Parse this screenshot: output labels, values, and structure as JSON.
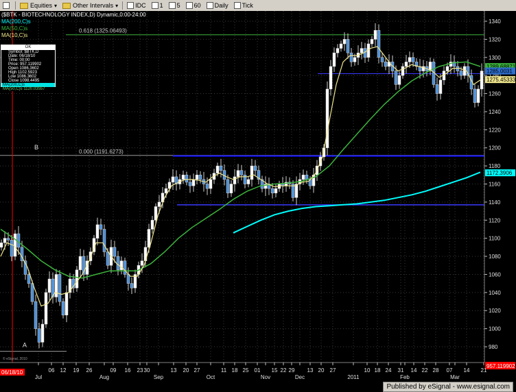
{
  "toolbar": {
    "items": [
      {
        "label": "Equities",
        "icon": "folder-icon"
      },
      {
        "label": "Other Intervals",
        "icon": "folder-icon"
      },
      {
        "label": "IDC",
        "icon": "box-icon"
      },
      {
        "label": "1",
        "icon": "box-icon"
      },
      {
        "label": "5",
        "icon": "box-icon"
      },
      {
        "label": "60",
        "icon": "box-icon"
      },
      {
        "label": "Daily",
        "icon": "box-icon"
      },
      {
        "label": "Tick",
        "icon": "box-icon"
      }
    ]
  },
  "header": {
    "title": "($BTK - BIOTECHNOLOGY INDEX,D) Dynamic,0:00-24:00",
    "legend": [
      {
        "label": "MA(200,C)s",
        "color": "#00ffff"
      },
      {
        "label": "MA(50,C)s",
        "color": "#3cb43c"
      },
      {
        "label": "MA(10,C)s",
        "color": "#f0e68c"
      }
    ]
  },
  "infobox": {
    "header": "OK",
    "rows": [
      "Symbol: $BTK,D",
      "Date: 06/18/10",
      "Time: 00:00",
      "Price: 957.119902",
      "Open 1086.3602",
      "High 1102.5923",
      "Low 1086.3602",
      "Close 1098.4495"
    ],
    "ma_rows": [
      {
        "label": "MA(200,C)s",
        "value": ""
      },
      {
        "label": "MA(50,C)s",
        "value": "1120.03557"
      }
    ]
  },
  "annotations": {
    "fib_618": "0.618 (1325.06493)",
    "fib_000": "0.000 (1191.6273)",
    "label_a": "A",
    "label_b": "B",
    "credit": "© eSignal, 2010"
  },
  "footer": {
    "published": "Published by eSignal - www.esignal.com",
    "date_marker": "06/18/10",
    "price_marker": "957.119902"
  },
  "colors": {
    "background": "#000000",
    "grid": "#3a3a3a",
    "candle": "#4a8fd8",
    "ma200": "#00ffff",
    "ma50": "#3cb43c",
    "ma10": "#f0e68c",
    "trendline": "#1a1aff",
    "fib_line": "#3cb43c",
    "cursor": "#ff0000",
    "price_marker": "#ff0000"
  },
  "chart_data": {
    "type": "candlestick",
    "y_range": [
      960,
      1340
    ],
    "y_ticks": [
      980,
      1000,
      1020,
      1040,
      1060,
      1080,
      1100,
      1120,
      1140,
      1160,
      1180,
      1200,
      1220,
      1240,
      1260,
      1280,
      1300,
      1320,
      1340
    ],
    "x_ticks": [
      "06/18/10",
      "Jul",
      "06",
      "12",
      "19",
      "26",
      "Aug",
      "09",
      "16",
      "23",
      "30",
      "Sep",
      "13",
      "20",
      "27",
      "Oct",
      "11",
      "18",
      "25",
      "01",
      "Nov",
      "15",
      "22",
      "29",
      "Dec",
      "13",
      "20",
      "27",
      "2011",
      "10",
      "18",
      "24",
      "31",
      "Feb",
      "14",
      "22",
      "28",
      "07",
      "Mar",
      "14",
      "21"
    ],
    "price_labels": [
      {
        "value": 1289.8852,
        "text": "1289.68871",
        "bg": "#3cb43c"
      },
      {
        "value": 1285.0031,
        "text": "1285.0031",
        "bg": "#2e6fd0"
      },
      {
        "value": 1275.4533,
        "text": "1275.45333",
        "bg": "#f0e68c"
      },
      {
        "value": 1172.3906,
        "text": "1172.3906",
        "bg": "#00ffff"
      }
    ],
    "horizontal_levels": [
      {
        "value": 1325.06,
        "name": "fib 0.618"
      },
      {
        "value": 1191.63,
        "name": "fib 0.000"
      },
      {
        "value": 1191,
        "name": "resistance"
      },
      {
        "value": 1137,
        "name": "support"
      },
      {
        "value": 1282,
        "name": "top channel"
      },
      {
        "value": 975,
        "name": "low A"
      }
    ],
    "ohlc_close_path": [
      [
        1,
        1095
      ],
      [
        6,
        1100
      ],
      [
        11,
        1098
      ],
      [
        16,
        1080
      ],
      [
        21,
        1105
      ],
      [
        26,
        1090
      ],
      [
        31,
        1075
      ],
      [
        36,
        1060
      ],
      [
        41,
        1050
      ],
      [
        46,
        1030
      ],
      [
        51,
        1000
      ],
      [
        56,
        985
      ],
      [
        61,
        1005
      ],
      [
        66,
        1040
      ],
      [
        71,
        1055
      ],
      [
        76,
        1035
      ],
      [
        81,
        1060
      ],
      [
        86,
        1030
      ],
      [
        91,
        1015
      ],
      [
        96,
        1040
      ],
      [
        101,
        1055
      ],
      [
        106,
        1045
      ],
      [
        111,
        1065
      ],
      [
        116,
        1080
      ],
      [
        121,
        1060
      ],
      [
        126,
        1075
      ],
      [
        131,
        1085
      ],
      [
        136,
        1100
      ],
      [
        141,
        1115
      ],
      [
        146,
        1110
      ],
      [
        151,
        1085
      ],
      [
        156,
        1070
      ],
      [
        161,
        1090
      ],
      [
        166,
        1080
      ],
      [
        171,
        1065
      ],
      [
        176,
        1075
      ],
      [
        181,
        1060
      ],
      [
        186,
        1050
      ],
      [
        191,
        1045
      ],
      [
        196,
        1060
      ],
      [
        201,
        1070
      ],
      [
        206,
        1075
      ],
      [
        211,
        1090
      ],
      [
        216,
        1110
      ],
      [
        221,
        1120
      ],
      [
        226,
        1135
      ],
      [
        231,
        1140
      ],
      [
        236,
        1150
      ],
      [
        241,
        1155
      ],
      [
        246,
        1162
      ],
      [
        251,
        1168
      ],
      [
        256,
        1160
      ],
      [
        261,
        1165
      ],
      [
        266,
        1170
      ],
      [
        271,
        1162
      ],
      [
        276,
        1158
      ],
      [
        281,
        1165
      ],
      [
        286,
        1170
      ],
      [
        291,
        1165
      ],
      [
        296,
        1160
      ],
      [
        301,
        1155
      ],
      [
        306,
        1165
      ],
      [
        311,
        1172
      ],
      [
        316,
        1180
      ],
      [
        321,
        1175
      ],
      [
        326,
        1165
      ],
      [
        331,
        1150
      ],
      [
        336,
        1160
      ],
      [
        341,
        1168
      ],
      [
        346,
        1175
      ],
      [
        351,
        1170
      ],
      [
        356,
        1160
      ],
      [
        361,
        1165
      ],
      [
        366,
        1180
      ],
      [
        371,
        1175
      ],
      [
        376,
        1165
      ],
      [
        381,
        1155
      ],
      [
        386,
        1160
      ],
      [
        391,
        1155
      ],
      [
        396,
        1150
      ],
      [
        401,
        1155
      ],
      [
        406,
        1160
      ],
      [
        411,
        1158
      ],
      [
        416,
        1162
      ],
      [
        421,
        1160
      ],
      [
        426,
        1145
      ],
      [
        431,
        1160
      ],
      [
        436,
        1165
      ],
      [
        441,
        1170
      ],
      [
        446,
        1165
      ],
      [
        451,
        1158
      ],
      [
        456,
        1170
      ],
      [
        461,
        1180
      ],
      [
        466,
        1190
      ],
      [
        471,
        1200
      ],
      [
        476,
        1265
      ],
      [
        481,
        1290
      ],
      [
        486,
        1305
      ],
      [
        491,
        1310
      ],
      [
        496,
        1315
      ],
      [
        501,
        1320
      ],
      [
        506,
        1305
      ],
      [
        511,
        1295
      ],
      [
        516,
        1300
      ],
      [
        521,
        1305
      ],
      [
        526,
        1310
      ],
      [
        531,
        1300
      ],
      [
        536,
        1315
      ],
      [
        541,
        1320
      ],
      [
        546,
        1330
      ],
      [
        551,
        1300
      ],
      [
        556,
        1295
      ],
      [
        561,
        1290
      ],
      [
        566,
        1295
      ],
      [
        571,
        1285
      ],
      [
        576,
        1270
      ],
      [
        581,
        1280
      ],
      [
        586,
        1290
      ],
      [
        591,
        1295
      ],
      [
        596,
        1300
      ],
      [
        601,
        1295
      ],
      [
        606,
        1290
      ],
      [
        611,
        1285
      ],
      [
        616,
        1290
      ],
      [
        621,
        1285
      ],
      [
        626,
        1295
      ],
      [
        631,
        1270
      ],
      [
        636,
        1260
      ],
      [
        641,
        1275
      ],
      [
        646,
        1285
      ],
      [
        651,
        1290
      ],
      [
        656,
        1295
      ],
      [
        661,
        1290
      ],
      [
        666,
        1285
      ],
      [
        671,
        1280
      ],
      [
        676,
        1290
      ],
      [
        681,
        1280
      ],
      [
        686,
        1265
      ],
      [
        691,
        1250
      ],
      [
        696,
        1265
      ],
      [
        701,
        1285
      ]
    ],
    "ma10_path": [
      [
        1,
        1080
      ],
      [
        10,
        1095
      ],
      [
        20,
        1092
      ],
      [
        30,
        1082
      ],
      [
        40,
        1068
      ],
      [
        50,
        1045
      ],
      [
        60,
        1025
      ],
      [
        70,
        1028
      ],
      [
        80,
        1040
      ],
      [
        90,
        1038
      ],
      [
        100,
        1040
      ],
      [
        110,
        1050
      ],
      [
        120,
        1060
      ],
      [
        130,
        1075
      ],
      [
        140,
        1095
      ],
      [
        150,
        1095
      ],
      [
        160,
        1082
      ],
      [
        170,
        1072
      ],
      [
        180,
        1066
      ],
      [
        190,
        1058
      ],
      [
        200,
        1058
      ],
      [
        210,
        1070
      ],
      [
        220,
        1095
      ],
      [
        230,
        1125
      ],
      [
        240,
        1145
      ],
      [
        250,
        1158
      ],
      [
        260,
        1162
      ],
      [
        270,
        1165
      ],
      [
        280,
        1165
      ],
      [
        290,
        1164
      ],
      [
        300,
        1162
      ],
      [
        310,
        1168
      ],
      [
        320,
        1172
      ],
      [
        330,
        1168
      ],
      [
        340,
        1165
      ],
      [
        350,
        1168
      ],
      [
        360,
        1168
      ],
      [
        370,
        1170
      ],
      [
        380,
        1165
      ],
      [
        390,
        1160
      ],
      [
        400,
        1157
      ],
      [
        410,
        1158
      ],
      [
        420,
        1158
      ],
      [
        430,
        1158
      ],
      [
        440,
        1162
      ],
      [
        450,
        1163
      ],
      [
        460,
        1172
      ],
      [
        470,
        1190
      ],
      [
        480,
        1230
      ],
      [
        490,
        1270
      ],
      [
        500,
        1295
      ],
      [
        510,
        1302
      ],
      [
        520,
        1302
      ],
      [
        530,
        1305
      ],
      [
        540,
        1310
      ],
      [
        550,
        1312
      ],
      [
        560,
        1302
      ],
      [
        570,
        1292
      ],
      [
        580,
        1285
      ],
      [
        590,
        1288
      ],
      [
        600,
        1292
      ],
      [
        610,
        1290
      ],
      [
        620,
        1288
      ],
      [
        630,
        1285
      ],
      [
        640,
        1278
      ],
      [
        650,
        1282
      ],
      [
        660,
        1288
      ],
      [
        670,
        1288
      ],
      [
        680,
        1285
      ],
      [
        690,
        1270
      ],
      [
        700,
        1275
      ]
    ],
    "ma50_path": [
      [
        1,
        1110
      ],
      [
        20,
        1100
      ],
      [
        40,
        1088
      ],
      [
        60,
        1075
      ],
      [
        80,
        1065
      ],
      [
        100,
        1058
      ],
      [
        120,
        1056
      ],
      [
        140,
        1060
      ],
      [
        160,
        1064
      ],
      [
        180,
        1064
      ],
      [
        200,
        1064
      ],
      [
        220,
        1072
      ],
      [
        240,
        1085
      ],
      [
        260,
        1100
      ],
      [
        280,
        1112
      ],
      [
        300,
        1122
      ],
      [
        320,
        1132
      ],
      [
        340,
        1143
      ],
      [
        360,
        1152
      ],
      [
        380,
        1158
      ],
      [
        400,
        1160
      ],
      [
        420,
        1161
      ],
      [
        440,
        1163
      ],
      [
        460,
        1168
      ],
      [
        480,
        1180
      ],
      [
        500,
        1198
      ],
      [
        520,
        1215
      ],
      [
        540,
        1232
      ],
      [
        560,
        1248
      ],
      [
        580,
        1262
      ],
      [
        600,
        1274
      ],
      [
        620,
        1283
      ],
      [
        640,
        1290
      ],
      [
        660,
        1294
      ],
      [
        680,
        1295
      ],
      [
        700,
        1290
      ]
    ],
    "ma200_path": [
      [
        340,
        1106
      ],
      [
        360,
        1113
      ],
      [
        380,
        1120
      ],
      [
        400,
        1126
      ],
      [
        420,
        1130
      ],
      [
        440,
        1133
      ],
      [
        460,
        1135
      ],
      [
        480,
        1136
      ],
      [
        500,
        1137
      ],
      [
        520,
        1138
      ],
      [
        540,
        1140
      ],
      [
        560,
        1142
      ],
      [
        580,
        1145
      ],
      [
        600,
        1148
      ],
      [
        620,
        1152
      ],
      [
        640,
        1157
      ],
      [
        660,
        1162
      ],
      [
        680,
        1167
      ],
      [
        700,
        1173
      ]
    ]
  }
}
